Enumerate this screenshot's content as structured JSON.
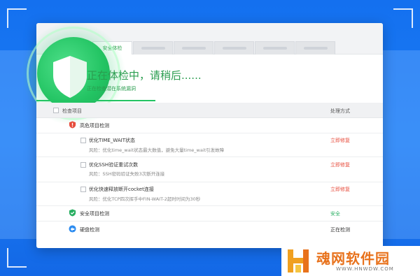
{
  "tabs": [
    {
      "label": "安全体检",
      "active": true
    },
    {
      "label": ""
    },
    {
      "label": ""
    },
    {
      "label": ""
    },
    {
      "label": ""
    },
    {
      "label": ""
    }
  ],
  "status": {
    "title": "正在体检中，请稍后......",
    "subtitle": "正在检查潜在系统漏洞",
    "progress": 0.344
  },
  "table": {
    "header_item": "检查项目",
    "header_action": "处理方式"
  },
  "categories": {
    "high_risk": {
      "title": "高危项目检测",
      "items": [
        {
          "title": "优化TIME_WAIT状态",
          "risk": "风险：优化time_wait状态最大数值，避免大量time_wait引发故障",
          "action": "立即修复"
        },
        {
          "title": "优化SSH验证重试次数",
          "risk": "风险：SSH密码验证失败3次断开连接",
          "action": "立即修复"
        },
        {
          "title": "优化快速释放断开cocket连接",
          "risk": "风险：优化TCP四次挥手中FIN-WAIT-2超时时间为30秒",
          "action": "立即修复"
        }
      ]
    },
    "safe": {
      "title": "安全项目检测",
      "action": "安全"
    },
    "disk": {
      "title": "硬盘检测",
      "action": "正在检测"
    }
  },
  "watermark": {
    "name": "魂网软件园",
    "url": "WWW.HNWDW.COM"
  },
  "colors": {
    "background": "#1470ef",
    "accent_green": "#23c463",
    "danger_red": "#e74c3c",
    "safe_green": "#27ae60",
    "logo_orange": "#e8721c"
  }
}
